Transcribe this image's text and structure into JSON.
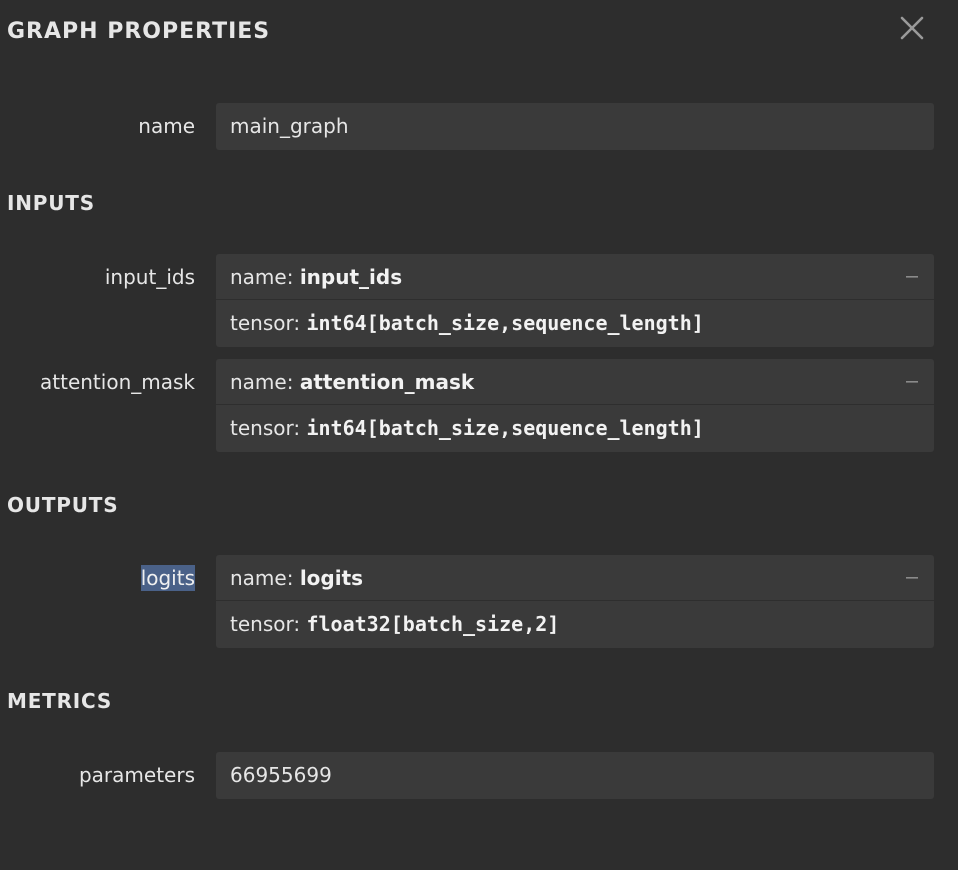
{
  "panel": {
    "title": "GRAPH PROPERTIES"
  },
  "icons": {
    "close": "close-icon",
    "collapse": "minus-icon"
  },
  "colors": {
    "background": "#2d2d2d",
    "field_background": "#3a3a3a",
    "selection_highlight": "#4a6188"
  },
  "graph": {
    "label": "name",
    "value": "main_graph"
  },
  "inputs": {
    "heading": "INPUTS",
    "items": [
      {
        "label": "input_ids",
        "name_key": "name:",
        "name_value": "input_ids",
        "tensor_key": "tensor:",
        "tensor_value": "int64[batch_size,sequence_length]"
      },
      {
        "label": "attention_mask",
        "name_key": "name:",
        "name_value": "attention_mask",
        "tensor_key": "tensor:",
        "tensor_value": "int64[batch_size,sequence_length]"
      }
    ]
  },
  "outputs": {
    "heading": "OUTPUTS",
    "items": [
      {
        "label": "logits",
        "name_key": "name:",
        "name_value": "logits",
        "tensor_key": "tensor:",
        "tensor_value": "float32[batch_size,2]"
      }
    ]
  },
  "metrics": {
    "heading": "METRICS",
    "parameters_label": "parameters",
    "parameters_value": "66955699"
  }
}
